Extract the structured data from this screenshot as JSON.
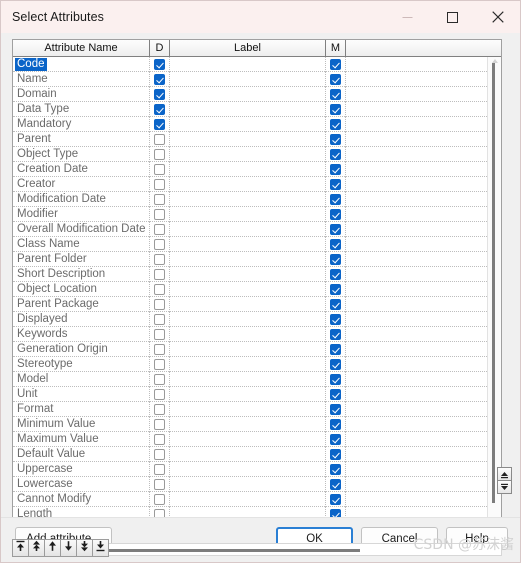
{
  "window": {
    "title": "Select Attributes",
    "controls": {
      "minimize": "minimize-icon",
      "maximize": "maximize-icon",
      "close": "close-icon"
    }
  },
  "grid": {
    "columns": [
      {
        "key": "name",
        "label": "Attribute Name"
      },
      {
        "key": "d",
        "label": "D"
      },
      {
        "key": "label",
        "label": "Label"
      },
      {
        "key": "m",
        "label": "M"
      },
      {
        "key": "rest",
        "label": ""
      }
    ],
    "rows": [
      {
        "name": "Code",
        "d": true,
        "label": "",
        "m": true,
        "selected": true
      },
      {
        "name": "Name",
        "d": true,
        "label": "",
        "m": true,
        "selected": false
      },
      {
        "name": "Domain",
        "d": true,
        "label": "",
        "m": true,
        "selected": false
      },
      {
        "name": "Data Type",
        "d": true,
        "label": "",
        "m": true,
        "selected": false
      },
      {
        "name": "Mandatory",
        "d": true,
        "label": "",
        "m": true,
        "selected": false
      },
      {
        "name": "Parent",
        "d": false,
        "label": "",
        "m": true,
        "selected": false
      },
      {
        "name": "Object Type",
        "d": false,
        "label": "",
        "m": true,
        "selected": false
      },
      {
        "name": "Creation Date",
        "d": false,
        "label": "",
        "m": true,
        "selected": false
      },
      {
        "name": "Creator",
        "d": false,
        "label": "",
        "m": true,
        "selected": false
      },
      {
        "name": "Modification Date",
        "d": false,
        "label": "",
        "m": true,
        "selected": false
      },
      {
        "name": "Modifier",
        "d": false,
        "label": "",
        "m": true,
        "selected": false
      },
      {
        "name": "Overall Modification Date",
        "d": false,
        "label": "",
        "m": true,
        "selected": false
      },
      {
        "name": "Class Name",
        "d": false,
        "label": "",
        "m": true,
        "selected": false
      },
      {
        "name": "Parent Folder",
        "d": false,
        "label": "",
        "m": true,
        "selected": false
      },
      {
        "name": "Short Description",
        "d": false,
        "label": "",
        "m": true,
        "selected": false
      },
      {
        "name": "Object Location",
        "d": false,
        "label": "",
        "m": true,
        "selected": false
      },
      {
        "name": "Parent Package",
        "d": false,
        "label": "",
        "m": true,
        "selected": false
      },
      {
        "name": "Displayed",
        "d": false,
        "label": "",
        "m": true,
        "selected": false
      },
      {
        "name": "Keywords",
        "d": false,
        "label": "",
        "m": true,
        "selected": false
      },
      {
        "name": "Generation Origin",
        "d": false,
        "label": "",
        "m": true,
        "selected": false
      },
      {
        "name": "Stereotype",
        "d": false,
        "label": "",
        "m": true,
        "selected": false
      },
      {
        "name": "Model",
        "d": false,
        "label": "",
        "m": true,
        "selected": false
      },
      {
        "name": "Unit",
        "d": false,
        "label": "",
        "m": true,
        "selected": false
      },
      {
        "name": "Format",
        "d": false,
        "label": "",
        "m": true,
        "selected": false
      },
      {
        "name": "Minimum Value",
        "d": false,
        "label": "",
        "m": true,
        "selected": false
      },
      {
        "name": "Maximum Value",
        "d": false,
        "label": "",
        "m": true,
        "selected": false
      },
      {
        "name": "Default Value",
        "d": false,
        "label": "",
        "m": true,
        "selected": false
      },
      {
        "name": "Uppercase",
        "d": false,
        "label": "",
        "m": true,
        "selected": false
      },
      {
        "name": "Lowercase",
        "d": false,
        "label": "",
        "m": true,
        "selected": false
      },
      {
        "name": "Cannot Modify",
        "d": false,
        "label": "",
        "m": true,
        "selected": false
      },
      {
        "name": "Length",
        "d": false,
        "label": "",
        "m": true,
        "selected": false
      }
    ]
  },
  "movebar": {
    "buttons": [
      {
        "name": "move-to-top-button",
        "icon": "arrow-to-top-icon"
      },
      {
        "name": "move-page-up-button",
        "icon": "double-arrow-up-icon"
      },
      {
        "name": "move-up-button",
        "icon": "arrow-up-icon"
      },
      {
        "name": "move-down-button",
        "icon": "arrow-down-icon"
      },
      {
        "name": "move-page-down-button",
        "icon": "double-arrow-down-icon"
      },
      {
        "name": "move-to-bottom-button",
        "icon": "arrow-to-bottom-icon"
      }
    ]
  },
  "footer": {
    "add_attribute": "Add attribute...",
    "ok": "OK",
    "cancel": "Cancel",
    "help": "Help"
  },
  "watermark": "CSDN @苏沫酱",
  "colors": {
    "titlebar": "#fbf0ef",
    "accent": "#0a64c8",
    "focus_border": "#2a7fd4",
    "row_text": "#6b6b6b"
  }
}
